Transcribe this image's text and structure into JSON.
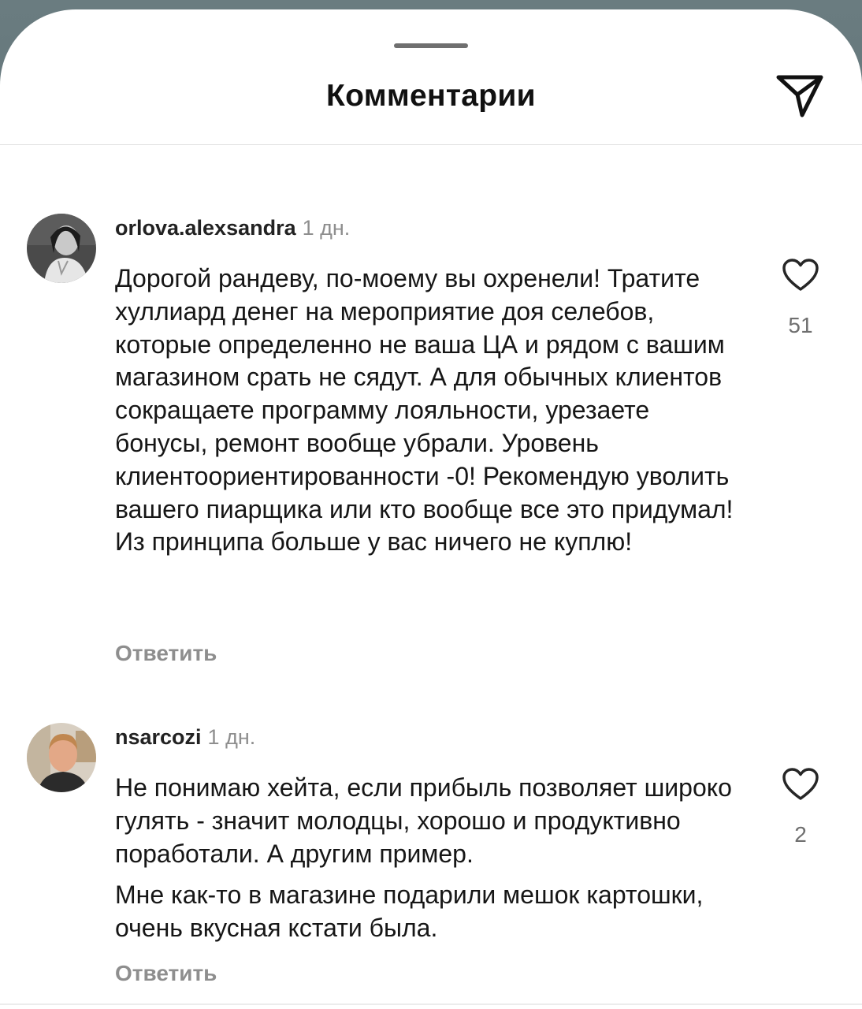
{
  "sheet": {
    "title": "Комментарии"
  },
  "comments": [
    {
      "username": "orlova.alexsandra",
      "time": "1 дн.",
      "paragraphs": [
        "Дорогой рандеву, по-моему вы охренели! Тратите хуллиард денег на мероприятие доя селебов, которые определенно не ваша ЦА и рядом с вашим магазином срать не сядут. А для обычных клиентов сокращаете программу лояльности, урезаете бонусы, ремонт вообще убрали. Уровень клиентоориентированности -0! Рекомендую уволить вашего пиарщика или кто вообще все это придумал! Из принципа больше у вас ничего не куплю!"
      ],
      "likes": "51",
      "reply_label": "Ответить"
    },
    {
      "username": "nsarcozi",
      "time": "1 дн.",
      "paragraphs": [
        "Не понимаю хейта, если прибыль позволяет широко гулять - значит молодцы, хорошо и продуктивно поработали. А другим пример.",
        "Мне как-то в магазине подарили мешок картошки, очень вкусная кстати была."
      ],
      "likes": "2",
      "reply_label": "Ответить"
    }
  ],
  "icons": {
    "share": "paper-plane-icon",
    "like": "heart-outline-icon"
  },
  "colors": {
    "background": "#ffffff",
    "text": "#161616",
    "secondary": "#8e8e8e"
  }
}
